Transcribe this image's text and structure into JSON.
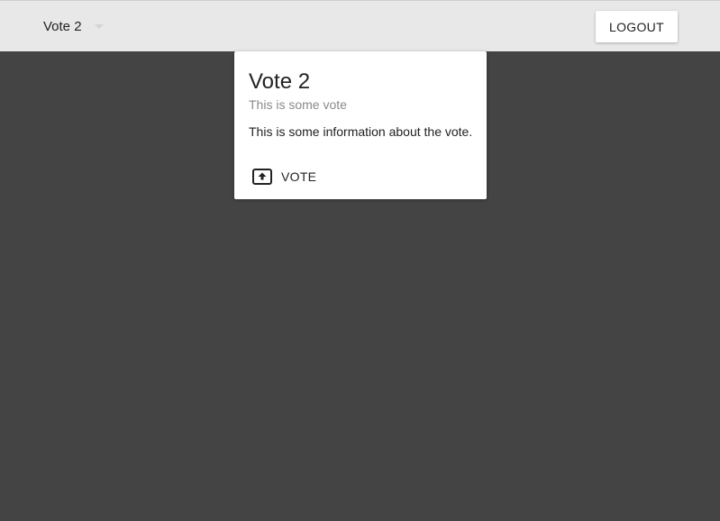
{
  "header": {
    "vote_selector": {
      "selected": "Vote 2",
      "icon": "dropdown-caret-icon"
    },
    "logout_label": "LOGOUT"
  },
  "card": {
    "title": "Vote 2",
    "subtitle": "This is some vote",
    "description": "This is some information about the vote.",
    "action": {
      "label": "VOTE",
      "icon": "upload-box-icon"
    }
  },
  "colors": {
    "background": "#444444",
    "topbar": "#e8e8e8",
    "card": "#ffffff",
    "text": "#222222",
    "subtitle_text": "#8a8a8a"
  }
}
